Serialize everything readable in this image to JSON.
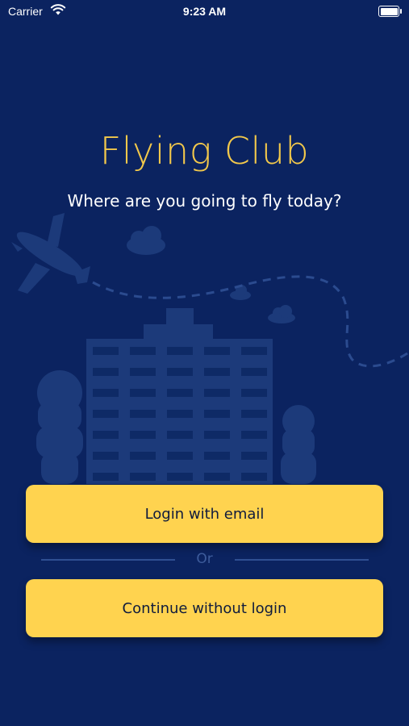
{
  "status_bar": {
    "carrier": "Carrier",
    "time": "9:23 AM",
    "wifi_icon": "wifi-icon",
    "battery_icon": "battery-icon",
    "battery_level": 1.0
  },
  "header": {
    "title": "Flying Club",
    "subtitle": "Where are you going to fly today?"
  },
  "illustration": {
    "elements": [
      "airplane-icon",
      "cloud-icon",
      "dashed-flight-path",
      "building-icon",
      "tree-icon"
    ]
  },
  "actions": {
    "login_email": "Login with email",
    "divider_or": "Or",
    "continue_guest": "Continue without login"
  },
  "colors": {
    "background": "#0b2360",
    "title": "#f2c84b",
    "button": "#ffd34f",
    "button_text": "#0f1b3d",
    "illustration": "#1c3a7a",
    "divider": "#2f4f92"
  }
}
